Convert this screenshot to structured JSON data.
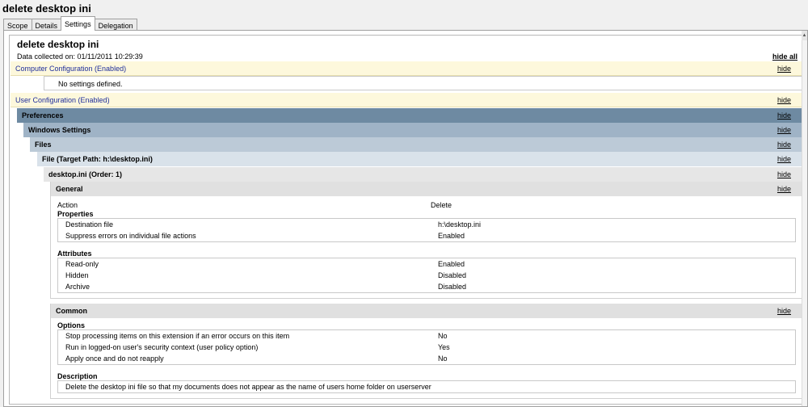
{
  "window": {
    "title": "delete desktop ini"
  },
  "tabs": [
    {
      "label": "Scope"
    },
    {
      "label": "Details"
    },
    {
      "label": "Settings"
    },
    {
      "label": "Delegation"
    }
  ],
  "report": {
    "title": "delete desktop ini",
    "collected": "Data collected on: 01/11/2011 10:29:39",
    "hide_all": "hide all",
    "hide": "hide",
    "computer_config": "Computer Configuration (Enabled)",
    "no_settings": "No settings defined.",
    "user_config": "User Configuration (Enabled)",
    "preferences": "Preferences",
    "windows_settings": "Windows Settings",
    "files": "Files",
    "file_target": "File (Target Path: h:\\desktop.ini)",
    "file_item": "desktop.ini (Order: 1)",
    "general": "General",
    "action_label": "Action",
    "action_value": "Delete",
    "properties": "Properties",
    "destination_label": "Destination file",
    "destination_value": "h:\\desktop.ini",
    "suppress_label": "Suppress errors on individual file actions",
    "suppress_value": "Enabled",
    "attributes": "Attributes",
    "readonly_label": "Read-only",
    "readonly_value": "Enabled",
    "hidden_label": "Hidden",
    "hidden_value": "Disabled",
    "archive_label": "Archive",
    "archive_value": "Disabled",
    "common": "Common",
    "options": "Options",
    "opt1_label": "Stop processing items on this extension if an error occurs on this item",
    "opt1_value": "No",
    "opt2_label": "Run in logged-on user's security context (user policy option)",
    "opt2_value": "Yes",
    "opt3_label": "Apply once and do not reapply",
    "opt3_value": "No",
    "description": "Description",
    "description_text": "Delete the desktop ini file so that my documents does not appear as the name of users home folder on userserver"
  },
  "icons": {
    "scroll_up": "scroll-up-arrow-icon"
  }
}
